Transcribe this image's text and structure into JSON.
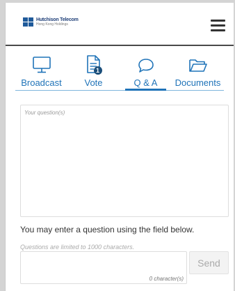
{
  "header": {
    "logo_name": "Hutchison Telecom",
    "logo_sub": "Hong Kong Holdings"
  },
  "tabs": [
    {
      "label": "Broadcast",
      "icon": "monitor-icon",
      "active": false
    },
    {
      "label": "Vote",
      "icon": "document-icon",
      "active": false,
      "badge": "1"
    },
    {
      "label": "Q & A",
      "icon": "speech-bubble-icon",
      "active": true
    },
    {
      "label": "Documents",
      "icon": "folder-icon",
      "active": false
    }
  ],
  "qa": {
    "question_placeholder": "Your question(s)",
    "info": "You may enter a question using the field below.",
    "limit_note": "Questions are limited to 1000  characters.",
    "char_count": "0 character(s)",
    "send_label": "Send"
  },
  "colors": {
    "accent": "#1f73b8",
    "badge": "#1b4e7a",
    "tab_line": "#7fb6dc"
  }
}
